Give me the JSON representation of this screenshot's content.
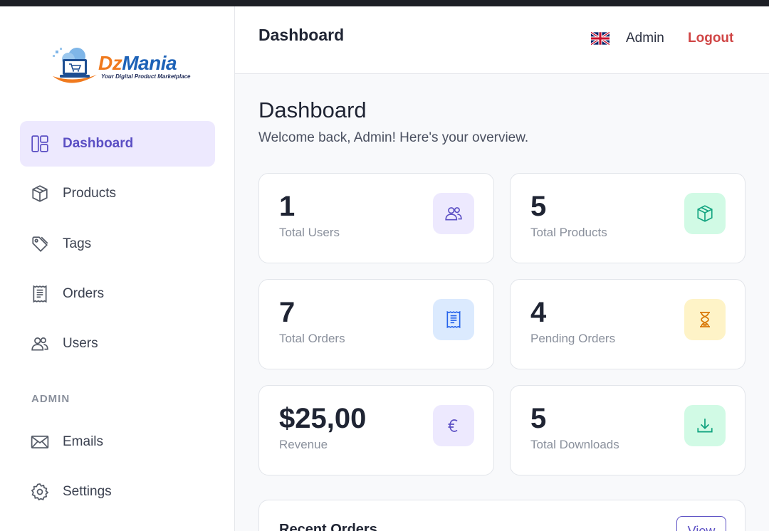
{
  "app": {
    "logo_brand": "DzMania",
    "logo_brand_first": "Dz",
    "logo_brand_rest": "Mania",
    "logo_tagline": "Your Digital Product Marketplace"
  },
  "sidebar": {
    "items": [
      {
        "label": "Dashboard",
        "icon": "layout-icon",
        "active": true
      },
      {
        "label": "Products",
        "icon": "box-icon"
      },
      {
        "label": "Tags",
        "icon": "tag-icon"
      },
      {
        "label": "Orders",
        "icon": "receipt-icon"
      },
      {
        "label": "Users",
        "icon": "users-icon"
      }
    ],
    "section_admin": "ADMIN",
    "admin_items": [
      {
        "label": "Emails",
        "icon": "envelope-icon"
      },
      {
        "label": "Settings",
        "icon": "gear-icon"
      }
    ]
  },
  "header": {
    "title": "Dashboard",
    "language_icon": "uk-flag-icon",
    "user": "Admin",
    "logout": "Logout"
  },
  "main": {
    "title": "Dashboard",
    "subtitle": "Welcome back, Admin! Here's your overview.",
    "stats": [
      {
        "value": "1",
        "label": "Total Users",
        "icon": "users-icon",
        "color": "#ede9fe",
        "icon_color": "#5b4fc4"
      },
      {
        "value": "5",
        "label": "Total Products",
        "icon": "box-icon",
        "color": "#d1fae5",
        "icon_color": "#10a37f"
      },
      {
        "value": "7",
        "label": "Total Orders",
        "icon": "receipt-icon",
        "color": "#dbeafe",
        "icon_color": "#2563eb"
      },
      {
        "value": "4",
        "label": "Pending Orders",
        "icon": "hourglass-icon",
        "color": "#fef3c7",
        "icon_color": "#d97706"
      },
      {
        "value": "$25,00",
        "label": "Revenue",
        "icon": "euro-icon",
        "color": "#ede9fe",
        "icon_color": "#5b4fc4"
      },
      {
        "value": "5",
        "label": "Total Downloads",
        "icon": "download-icon",
        "color": "#d1fae5",
        "icon_color": "#10a37f"
      }
    ],
    "recent_orders": {
      "title": "Recent Orders",
      "view_label": "View"
    }
  },
  "colors": {
    "accent": "#5b4fc4",
    "active_bg": "#ede9fe",
    "logout": "#d04545"
  }
}
